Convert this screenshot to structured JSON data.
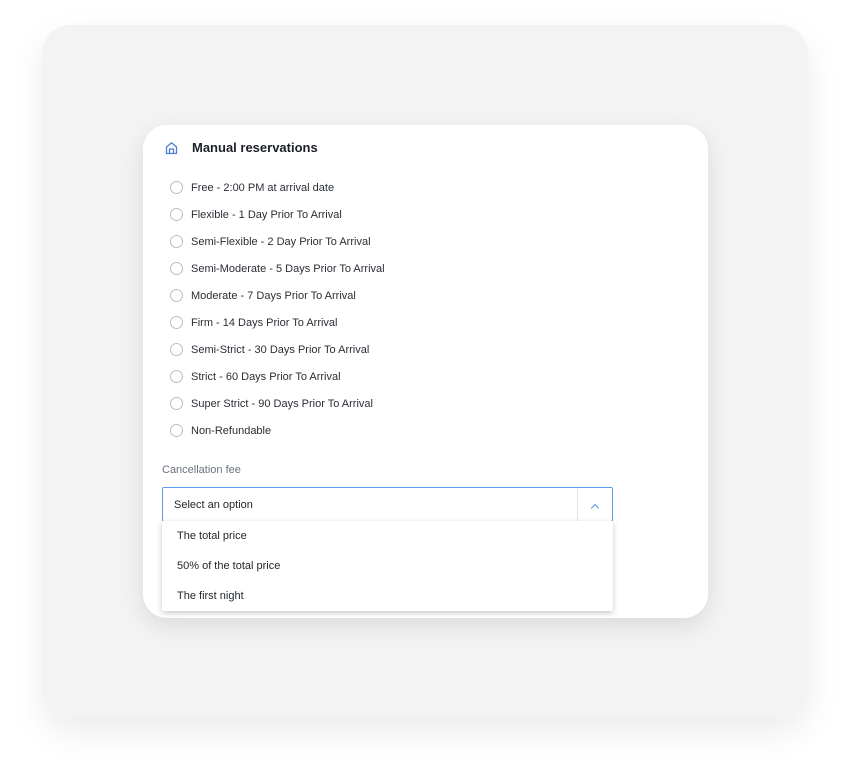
{
  "section": {
    "title": "Manual reservations",
    "icon": "home-icon"
  },
  "policies": [
    {
      "label": "Free - 2:00 PM at arrival date",
      "selected": false
    },
    {
      "label": "Flexible - 1 Day Prior To Arrival",
      "selected": false
    },
    {
      "label": "Semi-Flexible - 2 Day Prior To Arrival",
      "selected": false
    },
    {
      "label": "Semi-Moderate - 5 Days Prior To Arrival",
      "selected": false
    },
    {
      "label": "Moderate - 7 Days Prior To Arrival",
      "selected": false
    },
    {
      "label": "Firm - 14 Days Prior To Arrival",
      "selected": false
    },
    {
      "label": "Semi-Strict - 30 Days Prior To Arrival",
      "selected": false
    },
    {
      "label": "Strict - 60 Days Prior To Arrival",
      "selected": false
    },
    {
      "label": "Super Strict - 90 Days Prior To Arrival",
      "selected": false
    },
    {
      "label": "Non-Refundable",
      "selected": false
    }
  ],
  "cancellation_fee": {
    "label": "Cancellation fee",
    "placeholder": "Select an option",
    "options": [
      "The total price",
      "50% of the total price",
      "The first night"
    ],
    "open": true
  },
  "colors": {
    "accent": "#5b9bf0",
    "icon": "#4a7fd6"
  }
}
